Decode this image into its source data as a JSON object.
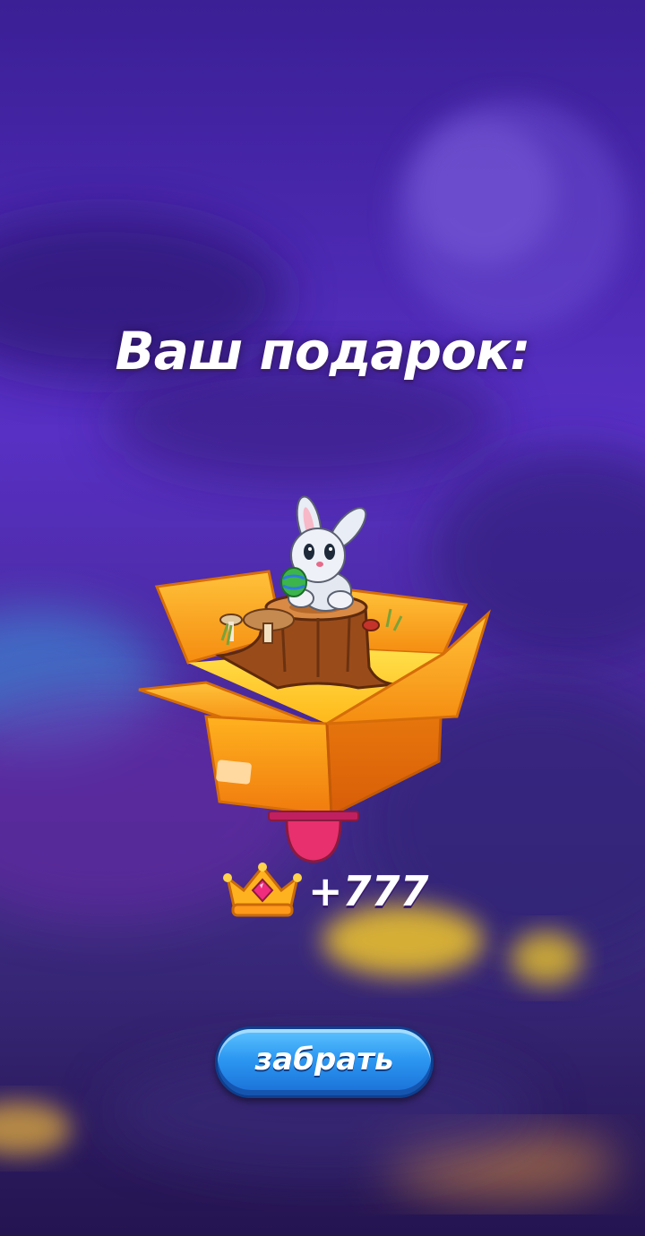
{
  "screen": {
    "title": "Ваш подарок:",
    "gift_icon": "gift-box-with-bunny",
    "reward": {
      "icon": "crown-icon",
      "amount": "+777"
    },
    "claim_button": "забрать"
  },
  "colors": {
    "background_top": "#3b1d8f",
    "background_mid": "#5a2bbd",
    "box_orange": "#ff9a1a",
    "button_blue": "#2c97f2",
    "ribbon_pink": "#e8306e"
  }
}
